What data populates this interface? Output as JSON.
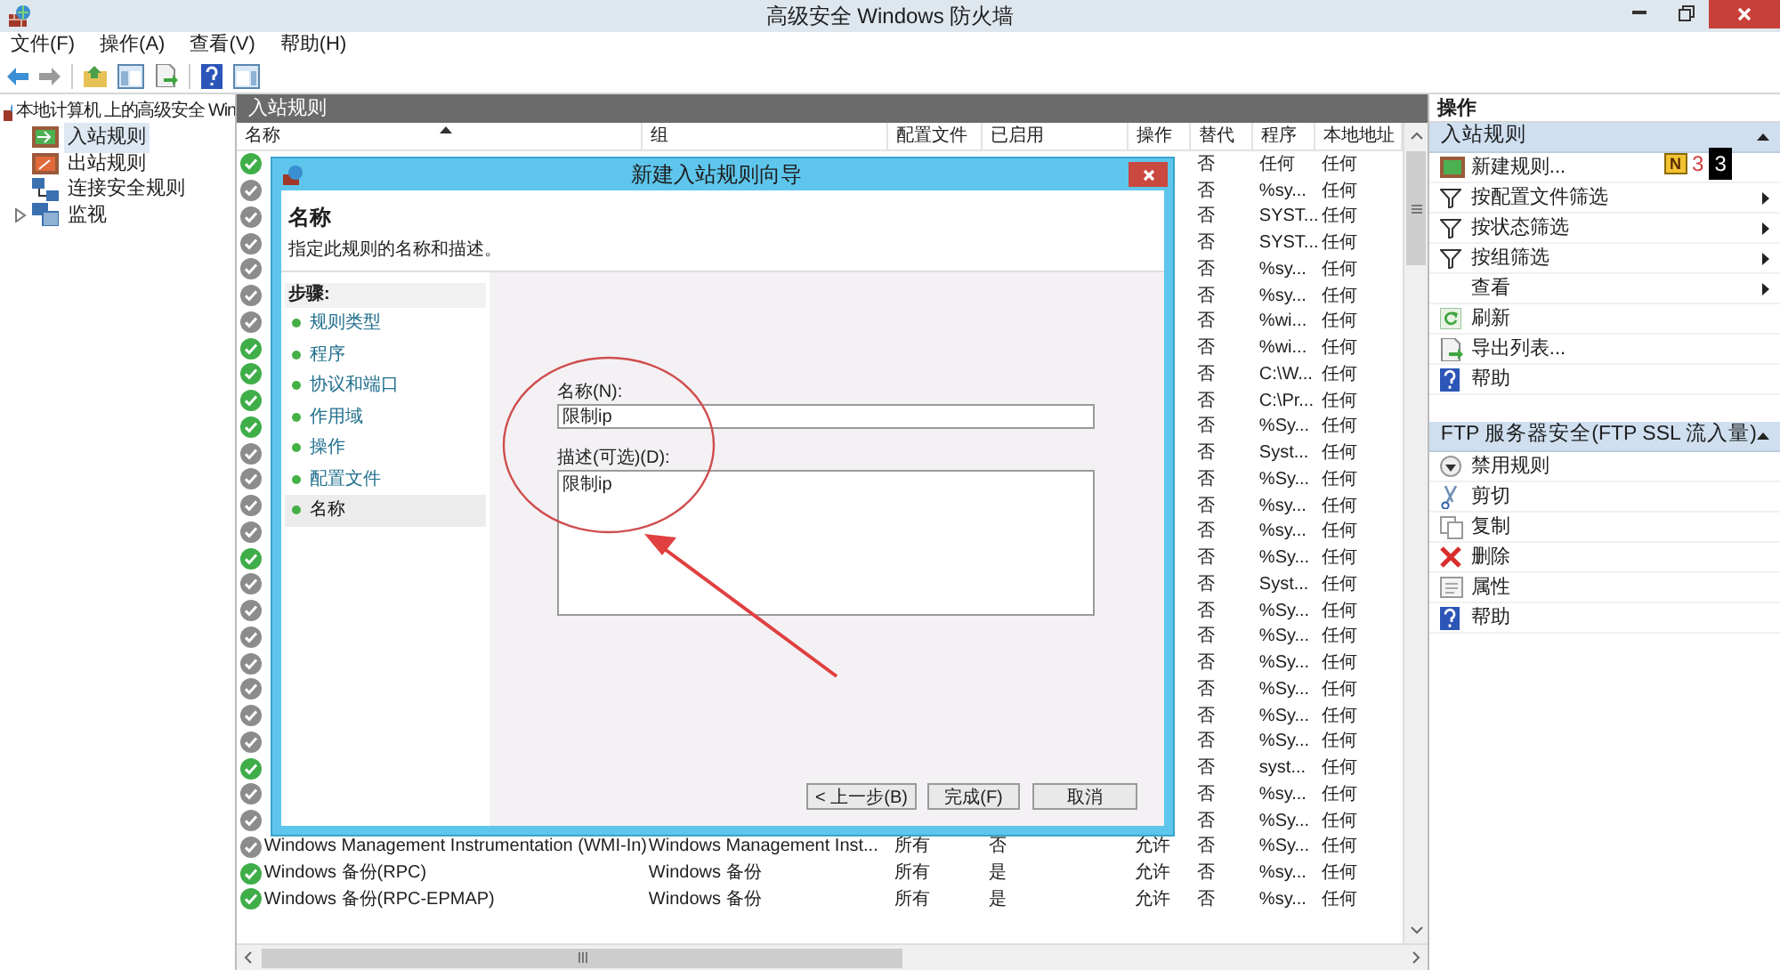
{
  "window": {
    "title": "高级安全 Windows 防火墙"
  },
  "menu": [
    "文件(F)",
    "操作(A)",
    "查看(V)",
    "帮助(H)"
  ],
  "tree": {
    "label": "本地计算机 上的高级安全 Win",
    "children": [
      {
        "label": "入站规则",
        "selected": true,
        "kind": "inbound"
      },
      {
        "label": "出站规则",
        "selected": false,
        "kind": "outbound"
      },
      {
        "label": "连接安全规则",
        "selected": false,
        "kind": "connection"
      },
      {
        "label": "监视",
        "selected": false,
        "kind": "monitor",
        "expanded": false
      }
    ]
  },
  "center": {
    "title": "入站规则",
    "columns": [
      "名称",
      "组",
      "配置文件",
      "已启用",
      "操作",
      "替代",
      "程序",
      "本地地址"
    ],
    "rows": [
      {
        "on": true,
        "override": "否",
        "program": "任何",
        "local": "任何"
      },
      {
        "on": false,
        "override": "否",
        "program": "%sy...",
        "local": "任何"
      },
      {
        "on": false,
        "override": "否",
        "program": "SYST...",
        "local": "任何"
      },
      {
        "on": false,
        "override": "否",
        "program": "SYST...",
        "local": "任何"
      },
      {
        "on": false,
        "override": "否",
        "program": "%sy...",
        "local": "任何"
      },
      {
        "on": false,
        "override": "否",
        "program": "%sy...",
        "local": "任何"
      },
      {
        "on": false,
        "override": "否",
        "program": "%wi...",
        "local": "任何"
      },
      {
        "on": true,
        "override": "否",
        "program": "%wi...",
        "local": "任何"
      },
      {
        "on": true,
        "override": "否",
        "program": "C:\\W...",
        "local": "任何"
      },
      {
        "on": true,
        "override": "否",
        "program": "C:\\Pr...",
        "local": "任何"
      },
      {
        "on": true,
        "override": "否",
        "program": "%Sy...",
        "local": "任何"
      },
      {
        "on": false,
        "override": "否",
        "program": "Syst...",
        "local": "任何"
      },
      {
        "on": false,
        "override": "否",
        "program": "%Sy...",
        "local": "任何"
      },
      {
        "on": false,
        "override": "否",
        "program": "%sy...",
        "local": "任何"
      },
      {
        "on": false,
        "override": "否",
        "program": "%sy...",
        "local": "任何"
      },
      {
        "on": true,
        "override": "否",
        "program": "%Sy...",
        "local": "任何"
      },
      {
        "on": false,
        "override": "否",
        "program": "Syst...",
        "local": "任何"
      },
      {
        "on": false,
        "override": "否",
        "program": "%Sy...",
        "local": "任何"
      },
      {
        "on": false,
        "override": "否",
        "program": "%Sy...",
        "local": "任何"
      },
      {
        "on": false,
        "override": "否",
        "program": "%Sy...",
        "local": "任何"
      },
      {
        "on": false,
        "override": "否",
        "program": "%Sy...",
        "local": "任何"
      },
      {
        "on": false,
        "override": "否",
        "program": "%Sy...",
        "local": "任何"
      },
      {
        "on": false,
        "override": "否",
        "program": "%Sy...",
        "local": "任何"
      },
      {
        "on": true,
        "override": "否",
        "program": "syst...",
        "local": "任何"
      },
      {
        "on": false,
        "override": "否",
        "program": "%sy...",
        "local": "任何"
      },
      {
        "on": false,
        "override": "否",
        "program": "%Sy...",
        "local": "任何"
      },
      {
        "on": false,
        "name": "Windows Management Instrumentation (WMI-In)",
        "group": "Windows Management Inst...",
        "profile": "所有",
        "enabled": "否",
        "action": "允许",
        "override": "否",
        "program": "%Sy...",
        "local": "任何"
      },
      {
        "on": true,
        "name": "Windows 备份(RPC)",
        "group": "Windows 备份",
        "profile": "所有",
        "enabled": "是",
        "action": "允许",
        "override": "否",
        "program": "%sy...",
        "local": "任何"
      },
      {
        "on": true,
        "name": "Windows 备份(RPC-EPMAP)",
        "group": "Windows 备份",
        "profile": "所有",
        "enabled": "是",
        "action": "允许",
        "override": "否",
        "program": "%sy...",
        "local": "任何"
      }
    ]
  },
  "actions": {
    "title": "操作",
    "sections": [
      {
        "title": "入站规则",
        "items": [
          {
            "label": "新建规则...",
            "kind": "new",
            "submenu": false
          },
          {
            "label": "按配置文件筛选",
            "kind": "filter",
            "submenu": true
          },
          {
            "label": "按状态筛选",
            "kind": "filter",
            "submenu": true
          },
          {
            "label": "按组筛选",
            "kind": "filter",
            "submenu": true
          },
          {
            "label": "查看",
            "kind": "plain",
            "submenu": true
          },
          {
            "label": "刷新",
            "kind": "refresh",
            "submenu": false
          },
          {
            "label": "导出列表...",
            "kind": "export",
            "submenu": false
          },
          {
            "label": "帮助",
            "kind": "help",
            "submenu": false
          }
        ]
      },
      {
        "title": "FTP 服务器安全(FTP SSL 流入量)",
        "items": [
          {
            "label": "禁用规则",
            "kind": "disable",
            "submenu": false
          },
          {
            "label": "剪切",
            "kind": "cut",
            "submenu": false
          },
          {
            "label": "复制",
            "kind": "copy",
            "submenu": false
          },
          {
            "label": "删除",
            "kind": "delete",
            "submenu": false
          },
          {
            "label": "属性",
            "kind": "properties",
            "submenu": false
          },
          {
            "label": "帮助",
            "kind": "help",
            "submenu": false
          }
        ]
      }
    ]
  },
  "overlay_badge": {
    "letter": "N",
    "counts": [
      "3",
      "3"
    ]
  },
  "dialog": {
    "title": "新建入站规则向导",
    "heading": "名称",
    "subheading": "指定此规则的名称和描述。",
    "steps_title": "步骤:",
    "steps": [
      {
        "label": "规则类型",
        "selected": false
      },
      {
        "label": "程序",
        "selected": false
      },
      {
        "label": "协议和端口",
        "selected": false
      },
      {
        "label": "作用域",
        "selected": false
      },
      {
        "label": "操作",
        "selected": false
      },
      {
        "label": "配置文件",
        "selected": false
      },
      {
        "label": "名称",
        "selected": true
      }
    ],
    "name_label": "名称(N):",
    "name_value": "限制ip",
    "desc_label": "描述(可选)(D):",
    "desc_value": "限制ip",
    "buttons": [
      "< 上一步(B)",
      "完成(F)",
      "取消"
    ]
  }
}
